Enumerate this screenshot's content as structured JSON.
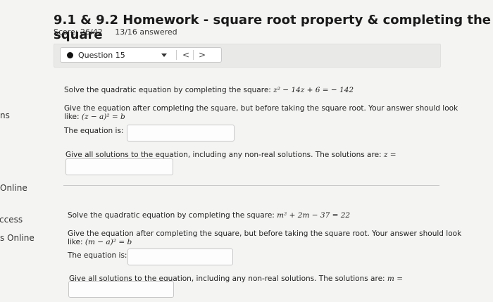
{
  "sidebar": {
    "fragments": [
      "ns",
      "Online",
      "ccess",
      "s Online"
    ]
  },
  "header": {
    "title": "9.1 & 9.2 Homework - square root property & completing the square",
    "score": "Score: 26/42",
    "answered": "13/16 answered"
  },
  "question_nav": {
    "label": "Question 15",
    "prev": "<",
    "next": ">"
  },
  "problems": [
    {
      "prompt": "Solve the quadratic equation by completing the square:",
      "equation": "z² − 14z + 6 = − 142",
      "instruction": "Give the equation after completing the square, but before taking the square root. Your answer should look",
      "like_prefix": "like:",
      "like_form": "(z − a)² = b",
      "equation_label": "The equation is:",
      "solutions_label": "Give all solutions to the equation, including any non-real solutions. The solutions are:",
      "solutions_var": "z ="
    },
    {
      "prompt": "Solve the quadratic equation by completing the square:",
      "equation": "m² + 2m − 37 = 22",
      "instruction": "Give the equation after completing the square, but before taking the square root. Your answer should look",
      "like_prefix": "like:",
      "like_form": "(m − a)² = b",
      "equation_label": "The equation is:",
      "solutions_label": "Give all solutions to the equation, including any non-real solutions. The solutions are:",
      "solutions_var": "m ="
    }
  ]
}
